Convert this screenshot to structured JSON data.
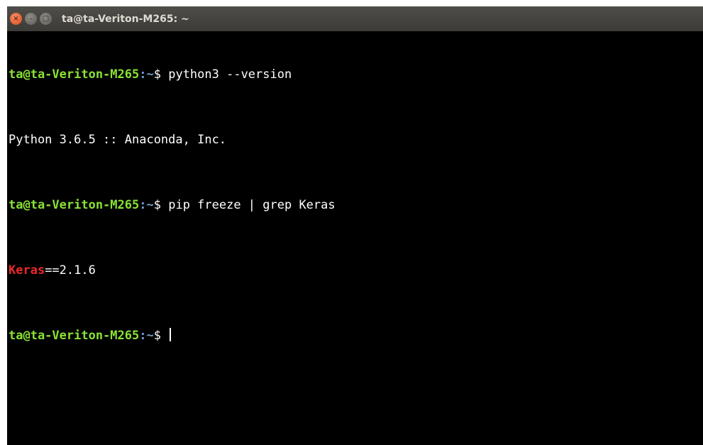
{
  "window": {
    "title": "ta@ta-Veriton-M265: ~",
    "close_glyph": "×",
    "minimize_glyph": "–",
    "maximize_glyph": "□"
  },
  "terminal": {
    "user_host": "ta@ta-Veriton-M265",
    "separator": ":",
    "cwd": "~",
    "prompt_symbol": "$ ",
    "lines": {
      "cmd1": "python3 --version",
      "out1": "Python 3.6.5 :: Anaconda, Inc.",
      "cmd2": "pip freeze | grep Keras",
      "out2_match": "Keras",
      "out2_rest": "==2.1.6"
    }
  },
  "colors": {
    "prompt_green": "#8ae234",
    "path_blue": "#729fcf",
    "match_red": "#ef2929",
    "background": "#000000",
    "titlebar": "#3c3b37"
  }
}
